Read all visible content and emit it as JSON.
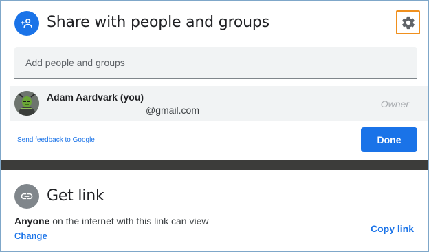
{
  "share": {
    "header_icon": "person-add-icon",
    "title": "Share with people and groups",
    "settings_icon": "gear-icon",
    "add_people_placeholder": "Add people and groups",
    "people": [
      {
        "name": "Adam Aardvark (you)",
        "email": "@gmail.com",
        "role": "Owner",
        "avatar": "avatar-image"
      }
    ],
    "feedback_label": "Send feedback to Google",
    "done_label": "Done"
  },
  "get_link": {
    "icon": "link-icon",
    "title": "Get link",
    "access_who": "Anyone",
    "access_rest": " on the internet with this link can view",
    "change_label": "Change",
    "copy_label": "Copy link"
  },
  "colors": {
    "accent": "#1a73e8",
    "settings_highlight": "#f0901e",
    "divider": "#3c3c3a",
    "row_bg": "#f1f3f4"
  }
}
